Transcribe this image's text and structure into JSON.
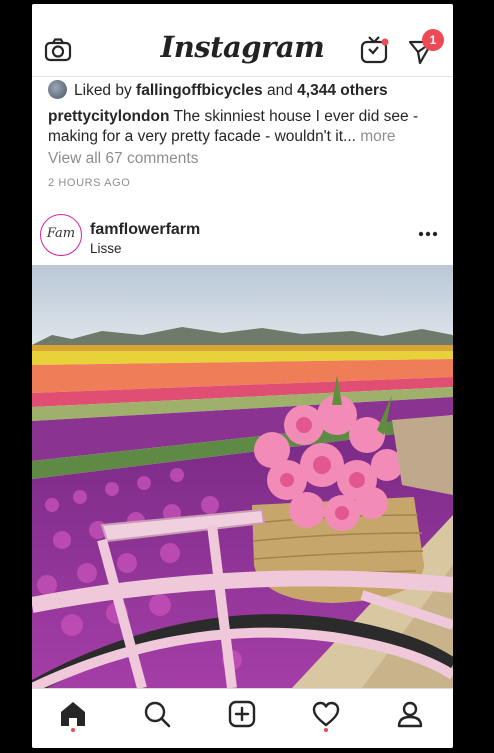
{
  "app": {
    "logo_text": "Instagram",
    "accent": "#ed4956"
  },
  "topbar": {
    "icons": [
      "camera-icon",
      "igtv-icon",
      "direct-message-icon"
    ],
    "dm_badge": "1"
  },
  "previous_post": {
    "likes_prefix": "Liked by ",
    "likes_user": "fallingoffbicycles",
    "likes_mid": " and ",
    "likes_count": "4,344 others",
    "caption_user": "prettycitylondon",
    "caption_text": " The skinniest house I ever did see - making for a very pretty facade - wouldn't it... ",
    "caption_more": "more",
    "view_comments": "View all 67 comments",
    "timestamp": "2 HOURS AGO"
  },
  "post": {
    "username": "famflowerfarm",
    "location": "Lisse",
    "avatar_text": "Fam",
    "menu_icon": "more-options-icon"
  },
  "bottom_nav": {
    "items": [
      "home-icon",
      "search-icon",
      "new-post-icon",
      "activity-heart-icon",
      "profile-icon"
    ],
    "active": "home-icon"
  }
}
